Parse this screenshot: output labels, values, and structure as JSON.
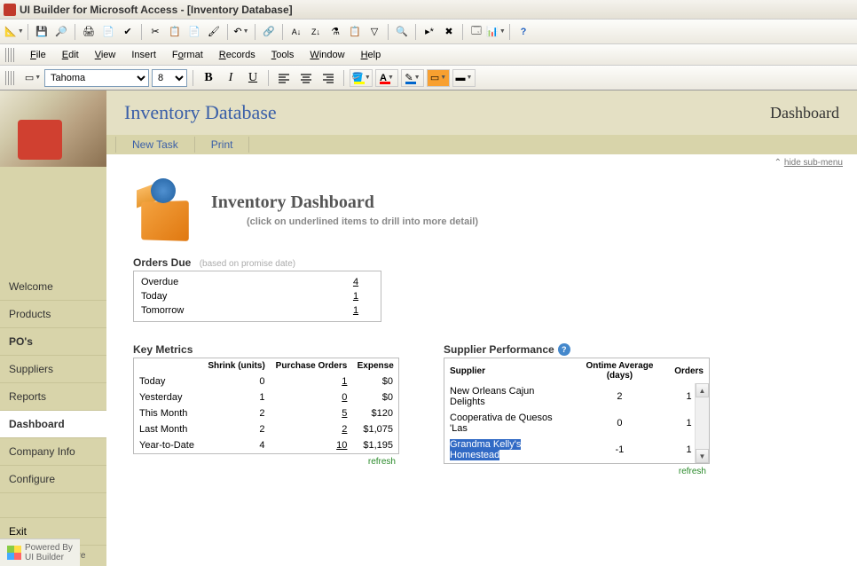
{
  "window": {
    "title": "UI Builder for Microsoft Access - [Inventory Database]"
  },
  "menus": {
    "file": "File",
    "edit": "Edit",
    "view": "View",
    "insert": "Insert",
    "format": "Format",
    "records": "Records",
    "tools": "Tools",
    "window": "Window",
    "help": "Help"
  },
  "format_toolbar": {
    "font_name": "Tahoma",
    "font_size": "8",
    "bold": "B",
    "italic": "I",
    "underline": "U"
  },
  "sidebar": {
    "items": [
      "Welcome",
      "Products",
      "PO's",
      "Suppliers",
      "Reports",
      "Dashboard",
      "Company Info",
      "Configure"
    ],
    "active_index": 5,
    "exit": "Exit",
    "footer": "OpenGate Software",
    "powered_by_line1": "Powered By",
    "powered_by_line2": "UI Builder"
  },
  "header": {
    "title": "Inventory Database",
    "page": "Dashboard"
  },
  "actions": {
    "new_task": "New Task",
    "print": "Print",
    "hide_submenu": "hide sub-menu"
  },
  "dashboard": {
    "title": "Inventory Dashboard",
    "subtitle": "(click on underlined items to drill into more detail)",
    "orders_due": {
      "title": "Orders Due",
      "subtitle": "(based on promise date)",
      "rows": [
        {
          "label": "Overdue",
          "value": "4"
        },
        {
          "label": "Today",
          "value": "1"
        },
        {
          "label": "Tomorrow",
          "value": "1"
        }
      ]
    },
    "key_metrics": {
      "title": "Key Metrics",
      "headers": [
        "",
        "Shrink (units)",
        "Purchase Orders",
        "Expense"
      ],
      "rows": [
        {
          "label": "Today",
          "shrink": "0",
          "po": "1",
          "expense": "$0"
        },
        {
          "label": "Yesterday",
          "shrink": "1",
          "po": "0",
          "expense": "$0"
        },
        {
          "label": "This Month",
          "shrink": "2",
          "po": "5",
          "expense": "$120"
        },
        {
          "label": "Last Month",
          "shrink": "2",
          "po": "2",
          "expense": "$1,075"
        },
        {
          "label": "Year-to-Date",
          "shrink": "4",
          "po": "10",
          "expense": "$1,195"
        }
      ],
      "refresh": "refresh"
    },
    "supplier_perf": {
      "title": "Supplier Performance",
      "headers": [
        "Supplier",
        "Ontime Average (days)",
        "Orders"
      ],
      "rows": [
        {
          "name": "New Orleans Cajun Delights",
          "ontime": "2",
          "orders": "1",
          "selected": false
        },
        {
          "name": "Cooperativa de Quesos 'Las",
          "ontime": "0",
          "orders": "1",
          "selected": false
        },
        {
          "name": "Grandma Kelly's Homestead",
          "ontime": "-1",
          "orders": "1",
          "selected": true
        }
      ],
      "refresh": "refresh"
    }
  }
}
